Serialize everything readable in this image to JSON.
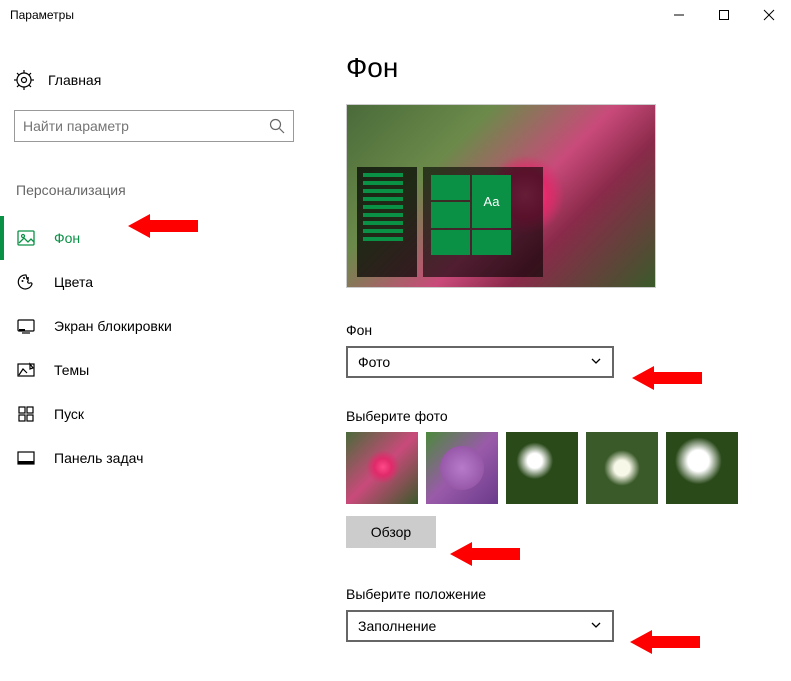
{
  "window": {
    "title": "Параметры"
  },
  "sidebar": {
    "home": "Главная",
    "search_placeholder": "Найти параметр",
    "category": "Персонализация",
    "items": [
      {
        "label": "Фон",
        "icon": "picture-icon",
        "selected": true
      },
      {
        "label": "Цвета",
        "icon": "palette-icon",
        "selected": false
      },
      {
        "label": "Экран блокировки",
        "icon": "lockscreen-icon",
        "selected": false
      },
      {
        "label": "Темы",
        "icon": "themes-icon",
        "selected": false
      },
      {
        "label": "Пуск",
        "icon": "start-icon",
        "selected": false
      },
      {
        "label": "Панель задач",
        "icon": "taskbar-icon",
        "selected": false
      }
    ]
  },
  "main": {
    "title": "Фон",
    "preview_sample_text": "Aa",
    "bg_label": "Фон",
    "bg_dropdown_value": "Фото",
    "choose_label": "Выберите фото",
    "browse_label": "Обзор",
    "fit_label": "Выберите положение",
    "fit_dropdown_value": "Заполнение"
  },
  "colors": {
    "accent": "#0a9146",
    "arrow": "#ff0000"
  }
}
